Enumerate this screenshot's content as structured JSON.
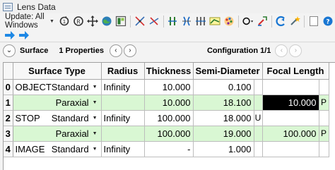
{
  "window": {
    "title": "Lens Data"
  },
  "toolbar": {
    "update_label": "Update: All Windows",
    "icons": [
      "refresh-icon",
      "radius-icon",
      "move-icon",
      "globe-icon",
      "layout-icon",
      "pickup-icon",
      "solve-icon",
      "layers-icon",
      "fold-icon",
      "split-icon",
      "scatter-icon",
      "palette-icon",
      "aperture-icon",
      "link-icon",
      "shade-icon",
      "blank-icon",
      "help-icon"
    ],
    "nav_icons": [
      "arrow-right-icon",
      "arrow-right-icon"
    ]
  },
  "propbar": {
    "surface_label": "Surface",
    "properties_label": "1 Properties",
    "config_label": "Configuration 1/1"
  },
  "table": {
    "headers": {
      "surface_type": "Surface Type",
      "radius": "Radius",
      "thickness": "Thickness",
      "semi_diameter": "Semi-Diameter",
      "focal_length": "Focal Length"
    },
    "rows": [
      {
        "num": "0",
        "name": "OBJECT",
        "type": "Standard",
        "radius": "Infinity",
        "thickness": "10.000",
        "semi": "0.100",
        "semi_solve": "",
        "focal": "",
        "focal_solve": ""
      },
      {
        "num": "1",
        "name": "",
        "type": "Paraxial",
        "radius": "",
        "thickness": "10.000",
        "semi": "18.100",
        "semi_solve": "",
        "focal": "10.000",
        "focal_solve": "P"
      },
      {
        "num": "2",
        "name": "STOP",
        "type": "Standard",
        "radius": "Infinity",
        "thickness": "100.000",
        "semi": "18.000",
        "semi_solve": "U",
        "focal": "",
        "focal_solve": ""
      },
      {
        "num": "3",
        "name": "",
        "type": "Paraxial",
        "radius": "",
        "thickness": "100.000",
        "semi": "19.000",
        "semi_solve": "",
        "focal": "100.000",
        "focal_solve": "P"
      },
      {
        "num": "4",
        "name": "IMAGE",
        "type": "Standard",
        "radius": "Infinity",
        "thickness": "-",
        "semi": "1.000",
        "semi_solve": "",
        "focal": "",
        "focal_solve": ""
      }
    ]
  }
}
